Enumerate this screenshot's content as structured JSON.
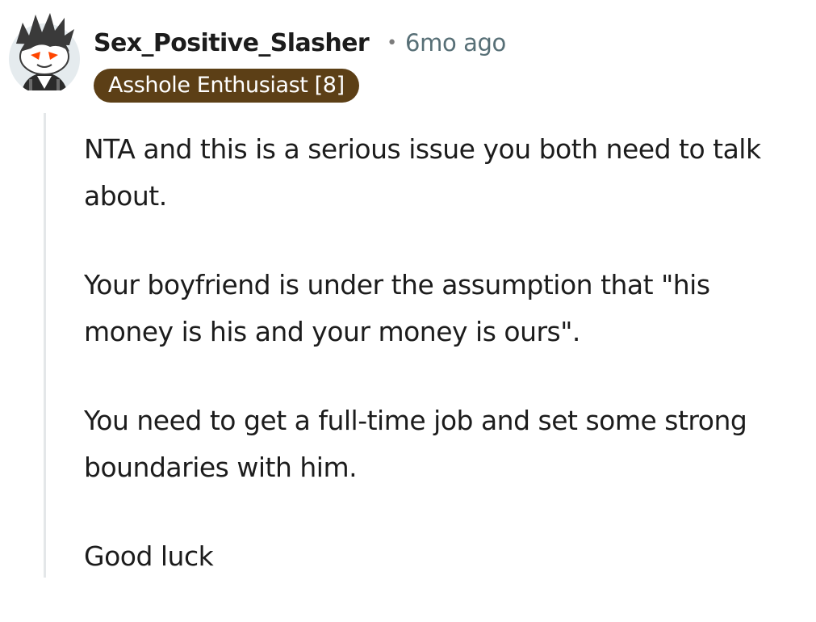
{
  "comment": {
    "author": {
      "username": "Sex_Positive_Slasher",
      "avatar_icon": "snoo-avatar-icon",
      "flair": "Asshole Enthusiast [8]",
      "flair_color": "#5c3f16"
    },
    "separator": "•",
    "timestamp": "6mo ago",
    "body": {
      "paragraphs": [
        "NTA and this is a serious issue you both need to talk about.",
        "Your boyfriend is under the assumption that \"his money is his and your money is ours\".",
        "You need to get a full-time job and set some strong boundaries with him.",
        "Good luck"
      ]
    }
  },
  "colors": {
    "text": "#1c1c1c",
    "meta": "#576f76",
    "thread_line": "#e4e7e9",
    "avatar_background": "#e5ebee"
  }
}
